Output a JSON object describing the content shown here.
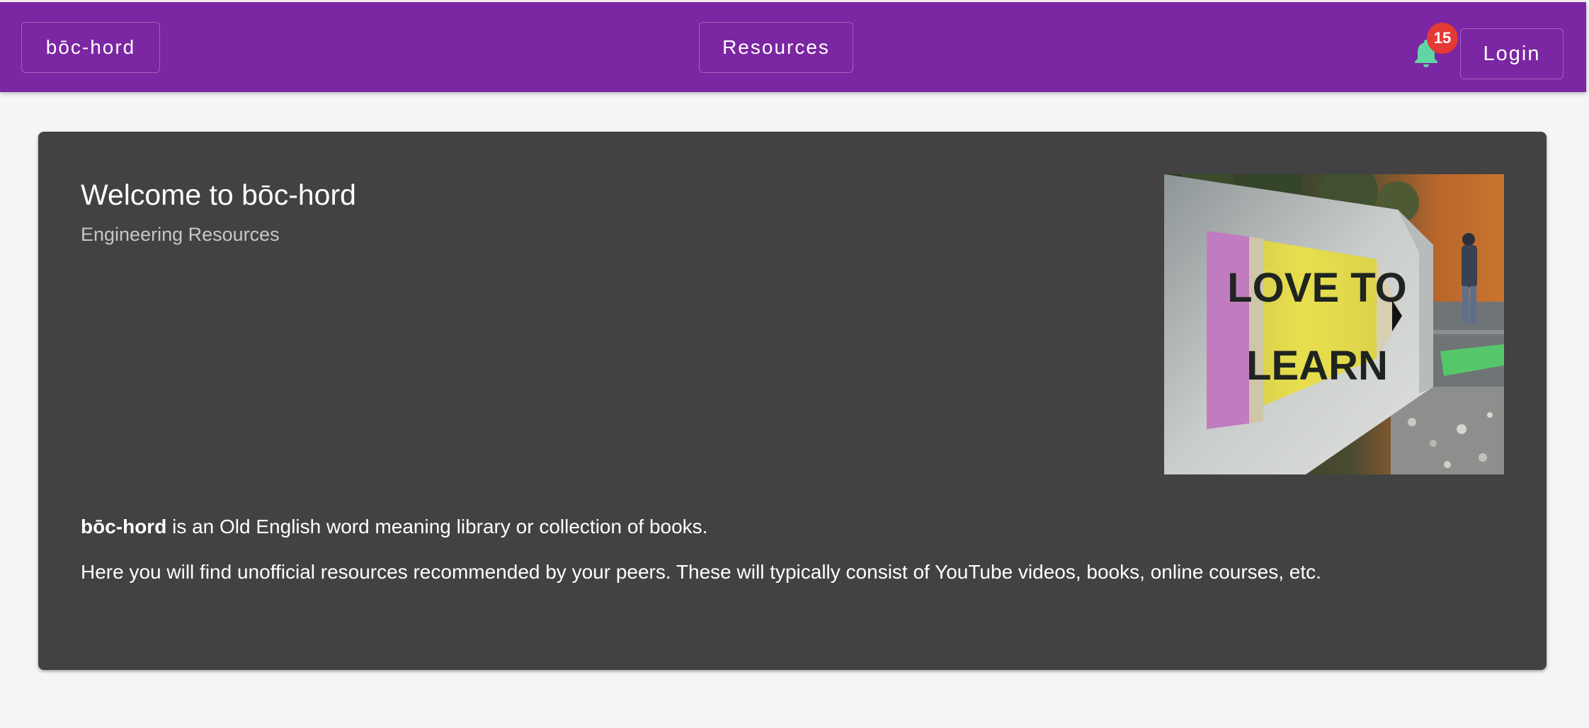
{
  "appbar": {
    "brand_label": "bōc-hord",
    "resources_label": "Resources",
    "notification_count": "15",
    "login_label": "Login",
    "color": "#7b26a2",
    "bell_color": "#5fd6a3",
    "badge_color": "#e53935"
  },
  "card": {
    "title": "Welcome to bōc-hord",
    "subtitle": "Engineering Resources",
    "image": {
      "sign_line1": "LOVE TO",
      "sign_line2": "LEARN"
    },
    "para1_bold": "bōc-hord",
    "para1_rest": " is an Old English word meaning library or collection of books.",
    "para2": "Here you will find unofficial resources recommended by your peers. These will typically consist of YouTube videos, books, online courses, etc."
  }
}
